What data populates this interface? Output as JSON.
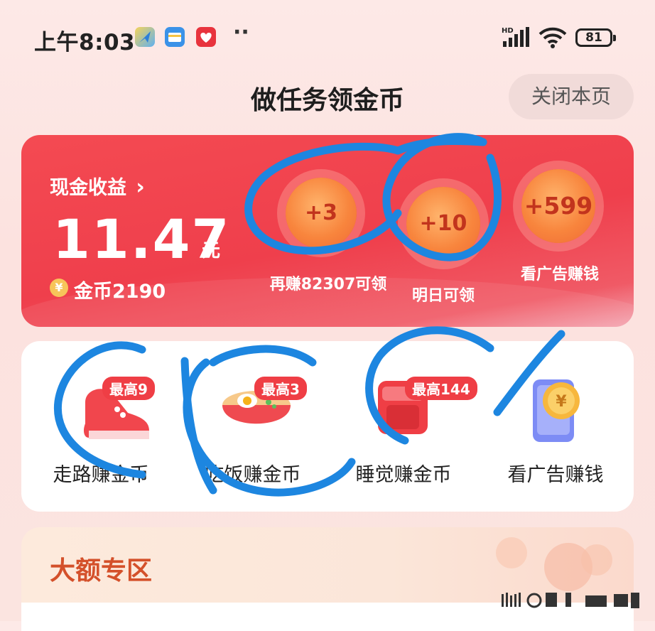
{
  "status_bar": {
    "time": "上午8:03",
    "dots": "··",
    "network": "HD",
    "battery": "81"
  },
  "header": {
    "title": "做任务领金币",
    "close_label": "关闭本页"
  },
  "earnings": {
    "cash_label": "现金收益",
    "chevron": "›",
    "amount": "11.47",
    "unit": "元",
    "coin_symbol": "¥",
    "coins": "金币2190",
    "bubbles": [
      {
        "value": "+3",
        "label": "再赚82307可领"
      },
      {
        "value": "+10",
        "label": "明日可领"
      },
      {
        "value": "+599",
        "label": "看广告赚钱"
      }
    ]
  },
  "tasks": [
    {
      "badge": "最高9",
      "label": "走路赚金币",
      "icon": "sneaker-icon"
    },
    {
      "badge": "最高3",
      "label": "吃饭赚金币",
      "icon": "noodle-bowl-icon"
    },
    {
      "badge": "最高144",
      "label": "睡觉赚金币",
      "icon": "alarm-clock-icon"
    },
    {
      "badge": "",
      "label": "看广告赚钱",
      "icon": "phone-coin-icon"
    }
  ],
  "zone": {
    "title": "大额专区"
  },
  "colors": {
    "accent_red": "#ef3f4c",
    "coin_orange": "#f8853d",
    "zone_title": "#d4502a",
    "ink_blue": "#1d86e0"
  }
}
